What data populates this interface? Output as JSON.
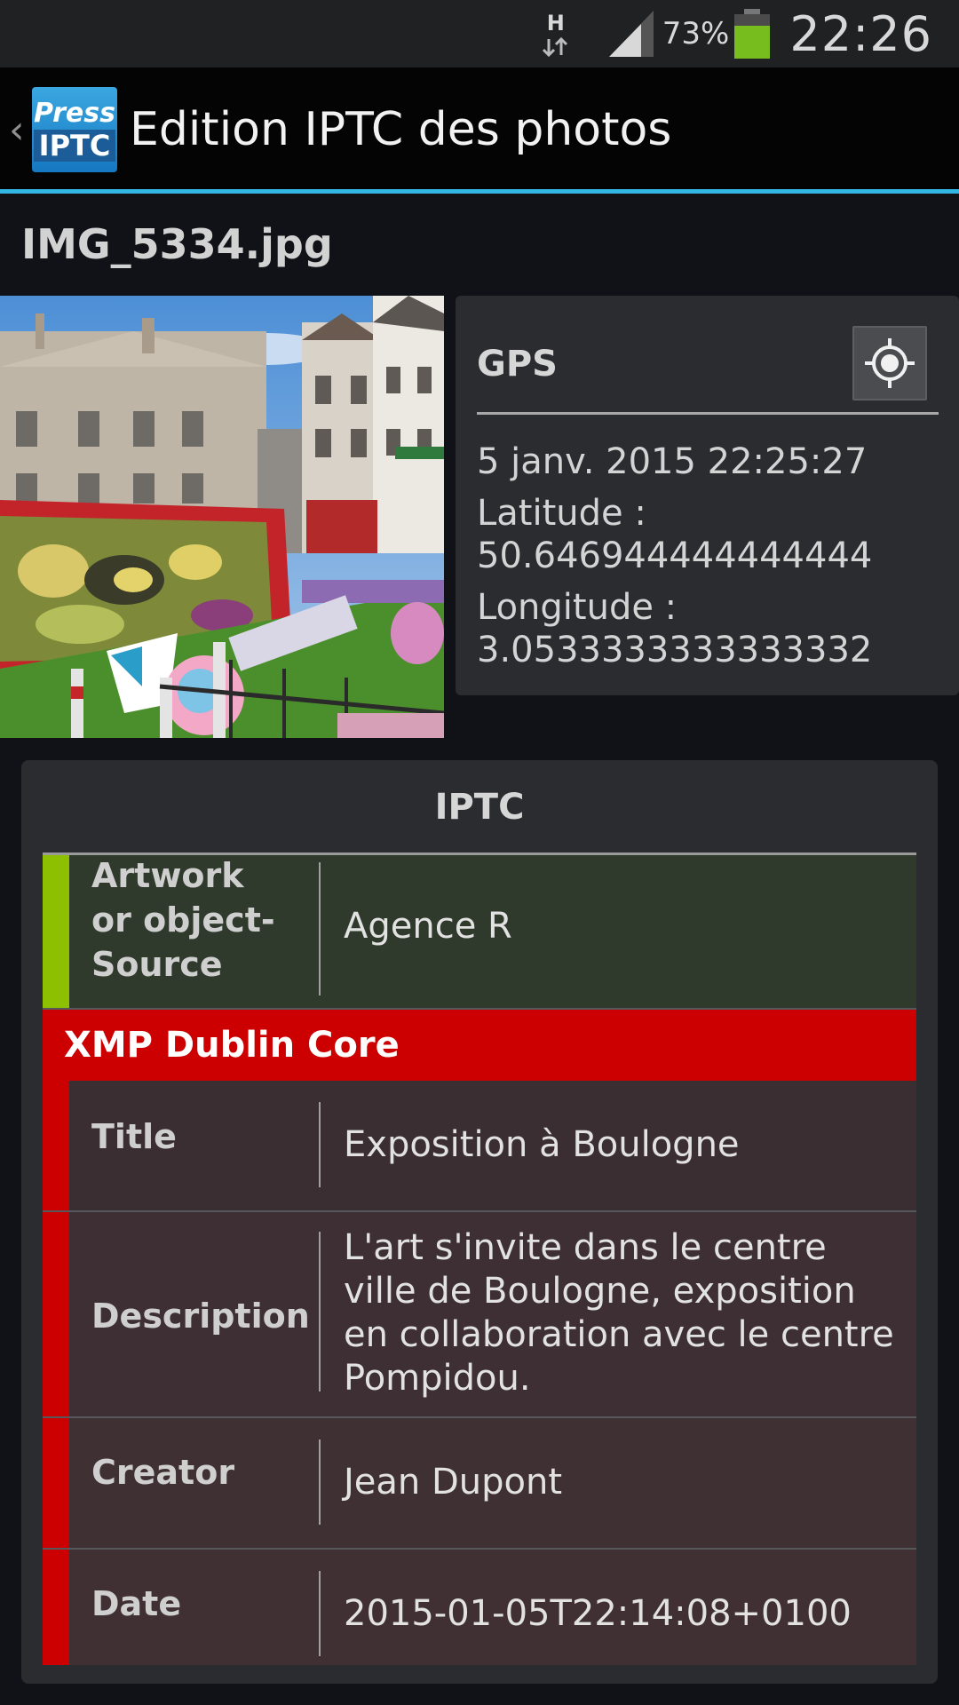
{
  "status_bar": {
    "network_type": "H",
    "battery_percent": "73%",
    "time": "22:26",
    "colors": {
      "battery_fill": "#76bd1d"
    }
  },
  "action_bar": {
    "logo_line1": "Press",
    "logo_line2": "IPTC",
    "title": "Edition IPTC des photos",
    "accent_color": "#33b5e5"
  },
  "file": {
    "name": "IMG_5334.jpg"
  },
  "gps": {
    "label": "GPS",
    "button_icon": "locate-crosshair-icon",
    "datetime": "5 janv. 2015 22:25:27",
    "latitude_label": "Latitude :",
    "latitude_value": "50.646944444444444",
    "longitude_label": "Longitude :",
    "longitude_value": "3.0533333333333332"
  },
  "iptc": {
    "title": "IPTC",
    "rows": [
      {
        "label": "Artwork or object-Source",
        "value": "Agence R",
        "bar_color": "#8dc000"
      }
    ],
    "section": {
      "title": "XMP Dublin Core",
      "color": "#cc0000",
      "rows": [
        {
          "label": "Title",
          "value": "Exposition à Boulogne"
        },
        {
          "label": "Description",
          "value": "L'art s'invite dans le centre ville de Boulogne, exposition en collaboration avec le centre Pompidou."
        },
        {
          "label": "Creator",
          "value": "Jean Dupont"
        },
        {
          "label": "Date",
          "value": "2015-01-05T22:14:08+0100"
        }
      ]
    }
  }
}
